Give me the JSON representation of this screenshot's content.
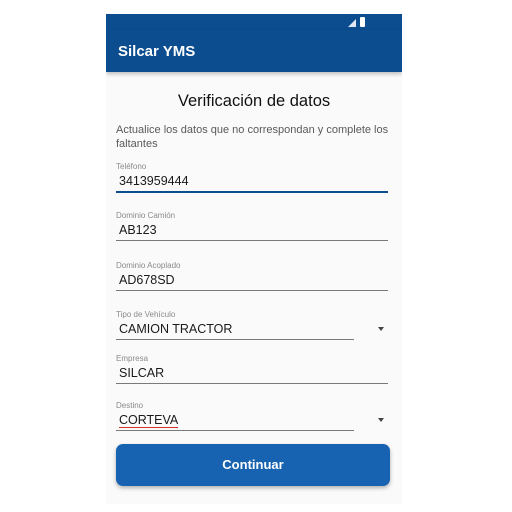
{
  "app": {
    "title": "Silcar YMS"
  },
  "form": {
    "title": "Verificación de datos",
    "instructions": "Actualice los datos que no correspondan y complete los faltantes",
    "fields": [
      {
        "label": "Teléfono",
        "value": "3413959444"
      },
      {
        "label": "Dominio Camión",
        "value": "AB123"
      },
      {
        "label": "Dominio Acoplado",
        "value": "AD678SD"
      },
      {
        "label": "Tipo de Vehículo",
        "value": "CAMION TRACTOR"
      },
      {
        "label": "Empresa",
        "value": "SILCAR"
      },
      {
        "label": "Destino",
        "value": "CORTEVA"
      }
    ],
    "submit_label": "Continuar"
  },
  "colors": {
    "primary": "#0b4d8f",
    "button": "#1762b1"
  }
}
